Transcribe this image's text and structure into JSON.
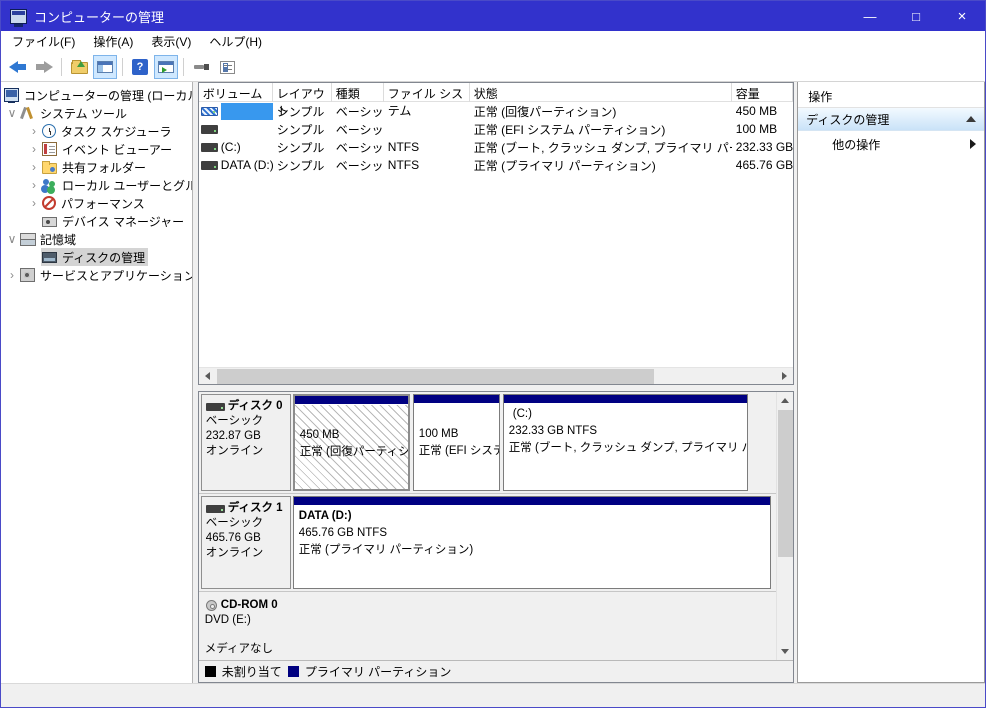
{
  "window": {
    "title": "コンピューターの管理",
    "minimize": "—",
    "maximize": "□",
    "close": "×"
  },
  "menu": {
    "items": [
      "ファイル(F)",
      "操作(A)",
      "表示(V)",
      "ヘルプ(H)"
    ]
  },
  "toolbar": {
    "help_glyph": "?",
    "icons": [
      "back",
      "forward",
      "up-one-level",
      "show-hide-console-tree",
      "help",
      "show-hide-action-pane",
      "context-tool",
      "export-list"
    ]
  },
  "tree": {
    "items": [
      {
        "label": "コンピューターの管理 (ローカル)",
        "icon": "computer",
        "expander": ""
      },
      {
        "label": "システム ツール",
        "icon": "system-tools",
        "expander": "∨"
      },
      {
        "label": "タスク スケジューラ",
        "icon": "task-scheduler",
        "expander": "›"
      },
      {
        "label": "イベント ビューアー",
        "icon": "event-viewer",
        "expander": "›"
      },
      {
        "label": "共有フォルダー",
        "icon": "shared-folders",
        "expander": "›"
      },
      {
        "label": "ローカル ユーザーとグループ",
        "icon": "local-users-and-groups",
        "expander": "›"
      },
      {
        "label": "パフォーマンス",
        "icon": "performance",
        "expander": "›"
      },
      {
        "label": "デバイス マネージャー",
        "icon": "device-manager",
        "expander": ""
      },
      {
        "label": "記憶域",
        "icon": "storage",
        "expander": "∨"
      },
      {
        "label": "ディスクの管理",
        "icon": "disk-management",
        "expander": ""
      },
      {
        "label": "サービスとアプリケーション",
        "icon": "services-and-applications",
        "expander": "›"
      }
    ]
  },
  "volume_table": {
    "columns": [
      "ボリューム",
      "レイアウト",
      "種類",
      "ファイル システム",
      "状態",
      "容量"
    ],
    "rows": [
      {
        "volume": "",
        "layout": "シンプル",
        "type": "ベーシック",
        "fs": "",
        "status": "正常 (回復パーティション)",
        "capacity": "450 MB"
      },
      {
        "volume": "",
        "layout": "シンプル",
        "type": "ベーシック",
        "fs": "",
        "status": "正常 (EFI システム パーティション)",
        "capacity": "100 MB"
      },
      {
        "volume": "(C:)",
        "layout": "シンプル",
        "type": "ベーシック",
        "fs": "NTFS",
        "status": "正常 (ブート, クラッシュ ダンプ, プライマリ パーティション)",
        "capacity": "232.33 GB"
      },
      {
        "volume": "DATA (D:)",
        "layout": "シンプル",
        "type": "ベーシック",
        "fs": "NTFS",
        "status": "正常 (プライマリ パーティション)",
        "capacity": "465.76 GB"
      }
    ]
  },
  "disk_view": {
    "disks": [
      {
        "name": "ディスク 0",
        "type": "ベーシック",
        "size": "232.87 GB",
        "status": "オンライン",
        "partitions": [
          {
            "line1": "450 MB",
            "line2": "正常 (回復パーティション)",
            "line3": ""
          },
          {
            "line1": "100 MB",
            "line2": "正常 (EFI システム パーティション)",
            "line3": ""
          },
          {
            "line1": "(C:)",
            "line2": "232.33 GB NTFS",
            "line3": "正常 (ブート, クラッシュ ダンプ, プライマリ パーティション)"
          }
        ]
      },
      {
        "name": "ディスク 1",
        "type": "ベーシック",
        "size": "465.76 GB",
        "status": "オンライン",
        "partitions": [
          {
            "line1": "DATA  (D:)",
            "line2": "465.76 GB NTFS",
            "line3": "正常 (プライマリ パーティション)"
          }
        ]
      }
    ],
    "cdrom": {
      "name": "CD-ROM 0",
      "drive": "DVD (E:)",
      "media": "メディアなし"
    },
    "legend": [
      {
        "label": "未割り当て",
        "color": "#000000"
      },
      {
        "label": "プライマリ パーティション",
        "color": "#000080"
      }
    ]
  },
  "actions": {
    "panel_title": "操作",
    "group_title": "ディスクの管理",
    "more_actions": "他の操作"
  }
}
